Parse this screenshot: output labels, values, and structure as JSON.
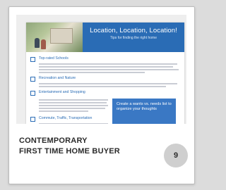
{
  "document": {
    "title": "Location, Location, Location!",
    "subtitle": "Tips for finding the right home",
    "sections": [
      {
        "title": "Top-rated Schools"
      },
      {
        "title": "Recreation and Nature"
      },
      {
        "title": "Entertainment and Shopping"
      },
      {
        "title": "Commute, Traffic, Transportation"
      }
    ],
    "callout": "Create a wants vs. needs list to organize your thoughts"
  },
  "caption": {
    "line1": "CONTEMPORARY",
    "line2": "FIRST TIME HOME BUYER"
  },
  "badge": "9",
  "colors": {
    "accent_blue": "#2a6cb5",
    "callout_blue": "#3a78c4",
    "badge_gray": "#cfcfcf",
    "background": "#dcdcdc"
  }
}
